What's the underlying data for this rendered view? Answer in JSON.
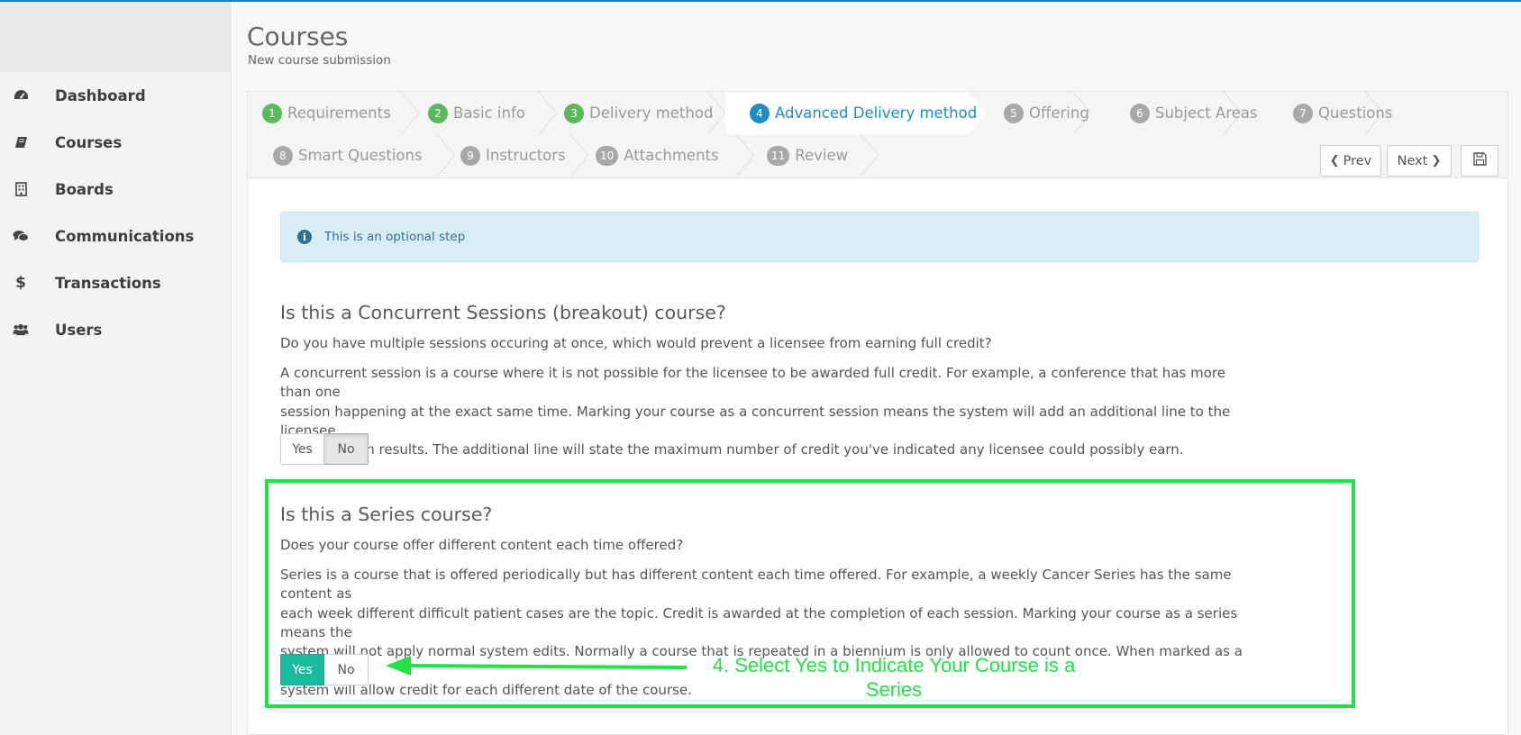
{
  "sidebar": {
    "items": [
      {
        "label": "Dashboard",
        "icon": "dashboard-icon"
      },
      {
        "label": "Courses",
        "icon": "book-icon"
      },
      {
        "label": "Boards",
        "icon": "building-icon"
      },
      {
        "label": "Communications",
        "icon": "comments-icon"
      },
      {
        "label": "Transactions",
        "icon": "dollar-icon"
      },
      {
        "label": "Users",
        "icon": "users-icon"
      }
    ]
  },
  "header": {
    "title": "Courses",
    "subtitle": "New course submission"
  },
  "steps": [
    {
      "num": "1",
      "label": "Requirements",
      "state": "done"
    },
    {
      "num": "2",
      "label": "Basic info",
      "state": "done"
    },
    {
      "num": "3",
      "label": "Delivery method",
      "state": "done"
    },
    {
      "num": "4",
      "label": "Advanced Delivery method",
      "state": "active"
    },
    {
      "num": "5",
      "label": "Offering",
      "state": "pending"
    },
    {
      "num": "6",
      "label": "Subject Areas",
      "state": "pending"
    },
    {
      "num": "7",
      "label": "Questions",
      "state": "pending"
    },
    {
      "num": "8",
      "label": "Smart Questions",
      "state": "pending"
    },
    {
      "num": "9",
      "label": "Instructors",
      "state": "pending"
    },
    {
      "num": "10",
      "label": "Attachments",
      "state": "pending"
    },
    {
      "num": "11",
      "label": "Review",
      "state": "pending"
    }
  ],
  "nav_buttons": {
    "prev": "Prev",
    "next": "Next",
    "save_icon": "save-icon"
  },
  "alert": {
    "text": "This is an optional step",
    "icon": "info-icon"
  },
  "concurrent": {
    "title": "Is this a Concurrent Sessions (breakout) course?",
    "question": "Do you have multiple sessions occuring at once, which would prevent a licensee from earning full credit?",
    "lines": [
      "A concurrent session is a course where it is not possible for the licensee to be awarded full credit. For example, a conference that has more than one",
      "session happening at the exact same time. Marking your course as a concurrent session means the system will add an additional line to the licensee",
      "course search results. The additional line will state the maximum number of credit you've indicated any licensee could possibly earn."
    ],
    "yes": "Yes",
    "no": "No",
    "selected": "No"
  },
  "series": {
    "title": "Is this a Series course?",
    "question": "Does your course offer different content each time offered?",
    "lines": [
      "Series is a course that is offered periodically but has different content each time offered. For example, a weekly Cancer Series has the same content as",
      "each week different difficult patient cases are the topic. Credit is awarded at the completion of each session. Marking your course as a series means the",
      "system will not apply normal system edits. Normally a course that is repeated in a biennium is only allowed to count once. When marked as a series, the",
      "system will allow credit for each different date of the course."
    ],
    "yes": "Yes",
    "no": "No",
    "selected": "Yes"
  },
  "annotation": {
    "line1": "4. Select Yes to Indicate Your Course is a",
    "line2": "Series",
    "color": "#22e244"
  },
  "colors": {
    "accent": "#1b8fc3",
    "done": "#5cb85c",
    "selected_yes": "#18bc9c",
    "alert_bg": "#d9edf7"
  }
}
